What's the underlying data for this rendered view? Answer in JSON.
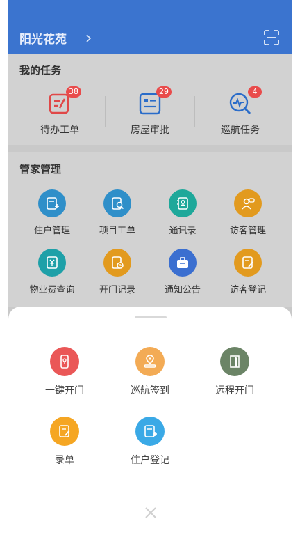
{
  "header": {
    "community_name": "阳光花苑",
    "colors": {
      "header_bg": "#3b74cf"
    }
  },
  "my_tasks": {
    "title": "我的任务",
    "items": [
      {
        "label": "待办工单",
        "badge": "38",
        "icon": "pending-order-icon"
      },
      {
        "label": "房屋审批",
        "badge": "29",
        "icon": "house-approval-icon"
      },
      {
        "label": "巡航任务",
        "badge": "4",
        "icon": "patrol-task-icon"
      }
    ]
  },
  "steward": {
    "title": "管家管理",
    "items": [
      {
        "label": "住户管理",
        "icon": "resident-manage-icon",
        "color": "#2f8fc9"
      },
      {
        "label": "项目工单",
        "icon": "project-order-icon",
        "color": "#2f8fc9"
      },
      {
        "label": "通讯录",
        "icon": "contacts-icon",
        "color": "#1ea89a"
      },
      {
        "label": "访客管理",
        "icon": "visitor-manage-icon",
        "color": "#e29a1e"
      },
      {
        "label": "物业费查询",
        "icon": "property-fee-icon",
        "color": "#1ea0a8"
      },
      {
        "label": "开门记录",
        "icon": "door-record-icon",
        "color": "#e29a1e"
      },
      {
        "label": "通知公告",
        "icon": "notice-icon",
        "color": "#3b6fd0"
      },
      {
        "label": "访客登记",
        "icon": "visitor-register-icon",
        "color": "#e29a1e"
      }
    ]
  },
  "sheet": {
    "items": [
      {
        "label": "一键开门",
        "icon": "one-key-open-icon",
        "color": "#ea5757"
      },
      {
        "label": "巡航签到",
        "icon": "patrol-checkin-icon",
        "color": "#f3ab55"
      },
      {
        "label": "远程开门",
        "icon": "remote-open-icon",
        "color": "#6b8466"
      },
      {
        "label": "录单",
        "icon": "record-order-icon",
        "color": "#f5a623"
      },
      {
        "label": "住户登记",
        "icon": "resident-register-icon",
        "color": "#3aa9e6"
      }
    ]
  }
}
